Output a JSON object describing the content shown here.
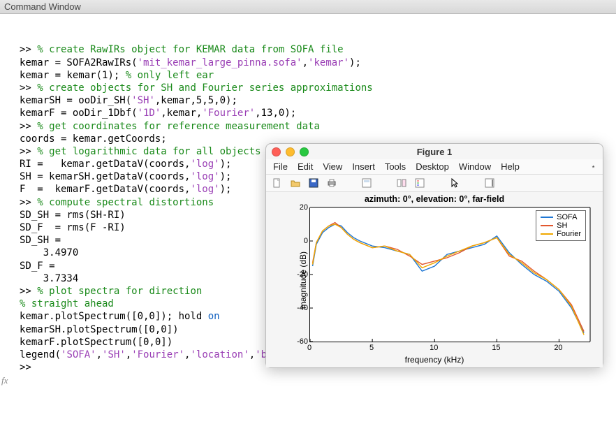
{
  "window_title": "Command Window",
  "code_lines": [
    {
      "segments": [
        {
          "t": ">> ",
          "c": "prompt"
        },
        {
          "t": "% create RawIRs object for KEMAR data from SOFA file",
          "c": "comment"
        }
      ]
    },
    {
      "segments": [
        {
          "t": "kemar = SOFA2RawIRs(",
          "c": "id"
        },
        {
          "t": "'mit_kemar_large_pinna.sofa'",
          "c": "string"
        },
        {
          "t": ",",
          "c": "id"
        },
        {
          "t": "'kemar'",
          "c": "string"
        },
        {
          "t": ");",
          "c": "id"
        }
      ]
    },
    {
      "segments": [
        {
          "t": "kemar = kemar(1); ",
          "c": "id"
        },
        {
          "t": "% only left ear",
          "c": "comment"
        }
      ]
    },
    {
      "segments": [
        {
          "t": ">> ",
          "c": "prompt"
        },
        {
          "t": "% create objects for SH and Fourier series approximations",
          "c": "comment"
        }
      ]
    },
    {
      "segments": [
        {
          "t": "kemarSH = ooDir_SH(",
          "c": "id"
        },
        {
          "t": "'SH'",
          "c": "string"
        },
        {
          "t": ",kemar,5,5,0);",
          "c": "id"
        }
      ]
    },
    {
      "segments": [
        {
          "t": "kemarF = ooDir_1Dbf(",
          "c": "id"
        },
        {
          "t": "'1D'",
          "c": "string"
        },
        {
          "t": ",kemar,",
          "c": "id"
        },
        {
          "t": "'Fourier'",
          "c": "string"
        },
        {
          "t": ",13,0);",
          "c": "id"
        }
      ]
    },
    {
      "segments": [
        {
          "t": ">> ",
          "c": "prompt"
        },
        {
          "t": "% get coordinates for reference measurement data",
          "c": "comment"
        }
      ]
    },
    {
      "segments": [
        {
          "t": "coords = kemar.getCoords;",
          "c": "id"
        }
      ]
    },
    {
      "segments": [
        {
          "t": ">> ",
          "c": "prompt"
        },
        {
          "t": "% get logarithmic data for all objects",
          "c": "comment"
        }
      ]
    },
    {
      "segments": [
        {
          "t": "RI =   kemar.getDataV(coords,",
          "c": "id"
        },
        {
          "t": "'log'",
          "c": "string"
        },
        {
          "t": ");",
          "c": "id"
        }
      ]
    },
    {
      "segments": [
        {
          "t": "SH = kemarSH.getDataV(coords,",
          "c": "id"
        },
        {
          "t": "'log'",
          "c": "string"
        },
        {
          "t": ");",
          "c": "id"
        }
      ]
    },
    {
      "segments": [
        {
          "t": "F  =  kemarF.getDataV(coords,",
          "c": "id"
        },
        {
          "t": "'log'",
          "c": "string"
        },
        {
          "t": ");",
          "c": "id"
        }
      ]
    },
    {
      "segments": [
        {
          "t": ">> ",
          "c": "prompt"
        },
        {
          "t": "% compute spectral distortions",
          "c": "comment"
        }
      ]
    },
    {
      "segments": [
        {
          "t": "SD_SH = rms(SH-RI)",
          "c": "id"
        }
      ]
    },
    {
      "segments": [
        {
          "t": "SD_F  = rms(F -RI)",
          "c": "id"
        }
      ]
    },
    {
      "segments": [
        {
          "t": "",
          "c": "id"
        }
      ]
    },
    {
      "segments": [
        {
          "t": "SD_SH =",
          "c": "id"
        }
      ]
    },
    {
      "segments": [
        {
          "t": "",
          "c": "id"
        }
      ]
    },
    {
      "segments": [
        {
          "t": "    3.4970",
          "c": "id"
        }
      ]
    },
    {
      "segments": [
        {
          "t": "",
          "c": "id"
        }
      ]
    },
    {
      "segments": [
        {
          "t": "",
          "c": "id"
        }
      ]
    },
    {
      "segments": [
        {
          "t": "SD_F =",
          "c": "id"
        }
      ]
    },
    {
      "segments": [
        {
          "t": "",
          "c": "id"
        }
      ]
    },
    {
      "segments": [
        {
          "t": "    3.7334",
          "c": "id"
        }
      ]
    },
    {
      "segments": [
        {
          "t": "",
          "c": "id"
        }
      ]
    },
    {
      "segments": [
        {
          "t": ">> ",
          "c": "prompt"
        },
        {
          "t": "% plot spectra for direction",
          "c": "comment"
        }
      ]
    },
    {
      "segments": [
        {
          "t": "% straight ahead",
          "c": "comment"
        }
      ]
    },
    {
      "segments": [
        {
          "t": "kemar.plotSpectrum([0,0]); hold ",
          "c": "id"
        },
        {
          "t": "on",
          "c": "keyword"
        }
      ]
    },
    {
      "segments": [
        {
          "t": "kemarSH.plotSpectrum([0,0])",
          "c": "id"
        }
      ]
    },
    {
      "segments": [
        {
          "t": "kemarF.plotSpectrum([0,0])",
          "c": "id"
        }
      ]
    },
    {
      "segments": [
        {
          "t": "legend(",
          "c": "id"
        },
        {
          "t": "'SOFA'",
          "c": "string"
        },
        {
          "t": ",",
          "c": "id"
        },
        {
          "t": "'SH'",
          "c": "string"
        },
        {
          "t": ",",
          "c": "id"
        },
        {
          "t": "'Fourier'",
          "c": "string"
        },
        {
          "t": ",",
          "c": "id"
        },
        {
          "t": "'location'",
          "c": "string"
        },
        {
          "t": ",",
          "c": "id"
        },
        {
          "t": "'best'",
          "c": "string"
        },
        {
          "t": ")",
          "c": "id"
        }
      ]
    },
    {
      "segments": [
        {
          "t": ">> ",
          "c": "prompt"
        }
      ]
    }
  ],
  "gutter_fx": "fx",
  "figure": {
    "title": "Figure 1",
    "menus": [
      "File",
      "Edit",
      "View",
      "Insert",
      "Tools",
      "Desktop",
      "Window",
      "Help"
    ],
    "toolbar_icons": [
      "new-file-icon",
      "open-folder-icon",
      "save-icon",
      "print-icon",
      "gap",
      "data-tip-icon",
      "gap",
      "link-icon",
      "legend-icon",
      "gap",
      "pointer-icon",
      "gap",
      "insert-colorbar-icon"
    ],
    "plot_title": "azimuth: 0°, elevation: 0°, far-field",
    "xlabel": "frequency (kHz)",
    "ylabel": "magnitude (dB)",
    "legend": [
      {
        "label": "SOFA",
        "color": "#1f77d4"
      },
      {
        "label": "SH",
        "color": "#e2572e"
      },
      {
        "label": "Fourier",
        "color": "#f0a800"
      }
    ]
  },
  "chart_data": {
    "type": "line",
    "title": "azimuth: 0°, elevation: 0°, far-field",
    "xlabel": "frequency (kHz)",
    "ylabel": "magnitude (dB)",
    "xlim": [
      0,
      22.5
    ],
    "ylim": [
      -60,
      20
    ],
    "xticks": [
      0,
      5,
      10,
      15,
      20
    ],
    "yticks": [
      -60,
      -40,
      -20,
      0,
      20
    ],
    "x": [
      0.2,
      0.5,
      1,
      1.5,
      2,
      2.5,
      3,
      3.5,
      4,
      5,
      6,
      7,
      8,
      9,
      10,
      11,
      12,
      13,
      14,
      15,
      16,
      17,
      18,
      19,
      20,
      21,
      22
    ],
    "series": [
      {
        "name": "SOFA",
        "color": "#1f77d4",
        "values": [
          -15,
          -2,
          5,
          8,
          10,
          9,
          5,
          2,
          0,
          -3,
          -4,
          -6,
          -8,
          -18,
          -15,
          -8,
          -6,
          -4,
          -2,
          3,
          -7,
          -14,
          -20,
          -24,
          -30,
          -40,
          -55
        ]
      },
      {
        "name": "SH",
        "color": "#e2572e",
        "values": [
          -13,
          -1,
          6,
          9,
          11,
          8,
          4,
          1,
          -1,
          -4,
          -3,
          -5,
          -9,
          -14,
          -12,
          -10,
          -7,
          -3,
          -1,
          2,
          -9,
          -12,
          -18,
          -23,
          -29,
          -38,
          -54
        ]
      },
      {
        "name": "Fourier",
        "color": "#f0a800",
        "values": [
          -14,
          -1,
          6,
          9,
          10,
          8,
          4,
          1,
          -1,
          -4,
          -3,
          -6,
          -8,
          -16,
          -13,
          -9,
          -6,
          -3,
          -1,
          2,
          -8,
          -13,
          -19,
          -23,
          -29,
          -39,
          -56
        ]
      }
    ]
  }
}
